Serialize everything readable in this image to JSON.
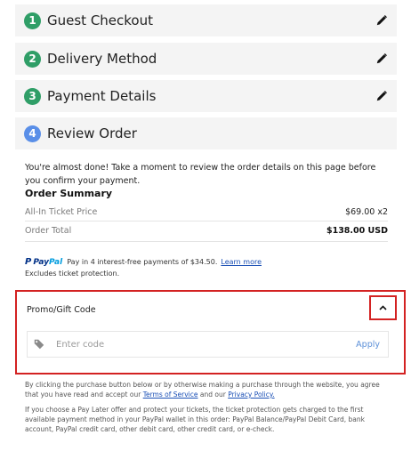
{
  "steps": [
    {
      "number": "1",
      "label": "Guest Checkout",
      "status": "done",
      "edit_icon": "pencil-icon"
    },
    {
      "number": "2",
      "label": "Delivery Method",
      "status": "done",
      "edit_icon": "pencil-icon"
    },
    {
      "number": "3",
      "label": "Payment Details",
      "status": "done",
      "edit_icon": "pencil-icon"
    },
    {
      "number": "4",
      "label": "Review Order",
      "status": "active"
    }
  ],
  "review": {
    "intro": "You're almost done! Take a moment to review the order details on this page before you confirm your payment.",
    "summary_title": "Order Summary",
    "ticket_price_label": "All-In Ticket Price",
    "ticket_price_value": "$69.00 x2",
    "order_total_label": "Order Total",
    "order_total_value": "$138.00 USD"
  },
  "paypal": {
    "logo_pay": "Pay",
    "logo_pal": "Pal",
    "message": "Pay in 4 interest-free payments of $34.50.",
    "learn_more": "Learn more",
    "excludes": "Excludes ticket protection."
  },
  "promo": {
    "label": "Promo/Gift Code",
    "placeholder": "Enter code",
    "value": "",
    "apply_label": "Apply",
    "toggle_icon": "chevron-up-icon",
    "field_icon": "tag-icon"
  },
  "legal": {
    "p1_before": "By clicking the purchase button below or by otherwise making a purchase through the website, you agree that you have read and accept our ",
    "terms_link": "Terms of Service",
    "p1_middle": " and our ",
    "privacy_link": "Privacy Policy.",
    "p2": "If you choose a Pay Later offer and protect your tickets, the ticket protection gets charged to the first available payment method in your PayPal wallet in this order: PayPal Balance/PayPal Debit Card, bank account, PayPal credit card, other debit card, other credit card, or e-check."
  },
  "colors": {
    "step_done": "#2f9e67",
    "step_active": "#5a8fe8",
    "highlight_border": "#d32222",
    "link": "#1a4fb5",
    "apply": "#5b8fd8"
  }
}
